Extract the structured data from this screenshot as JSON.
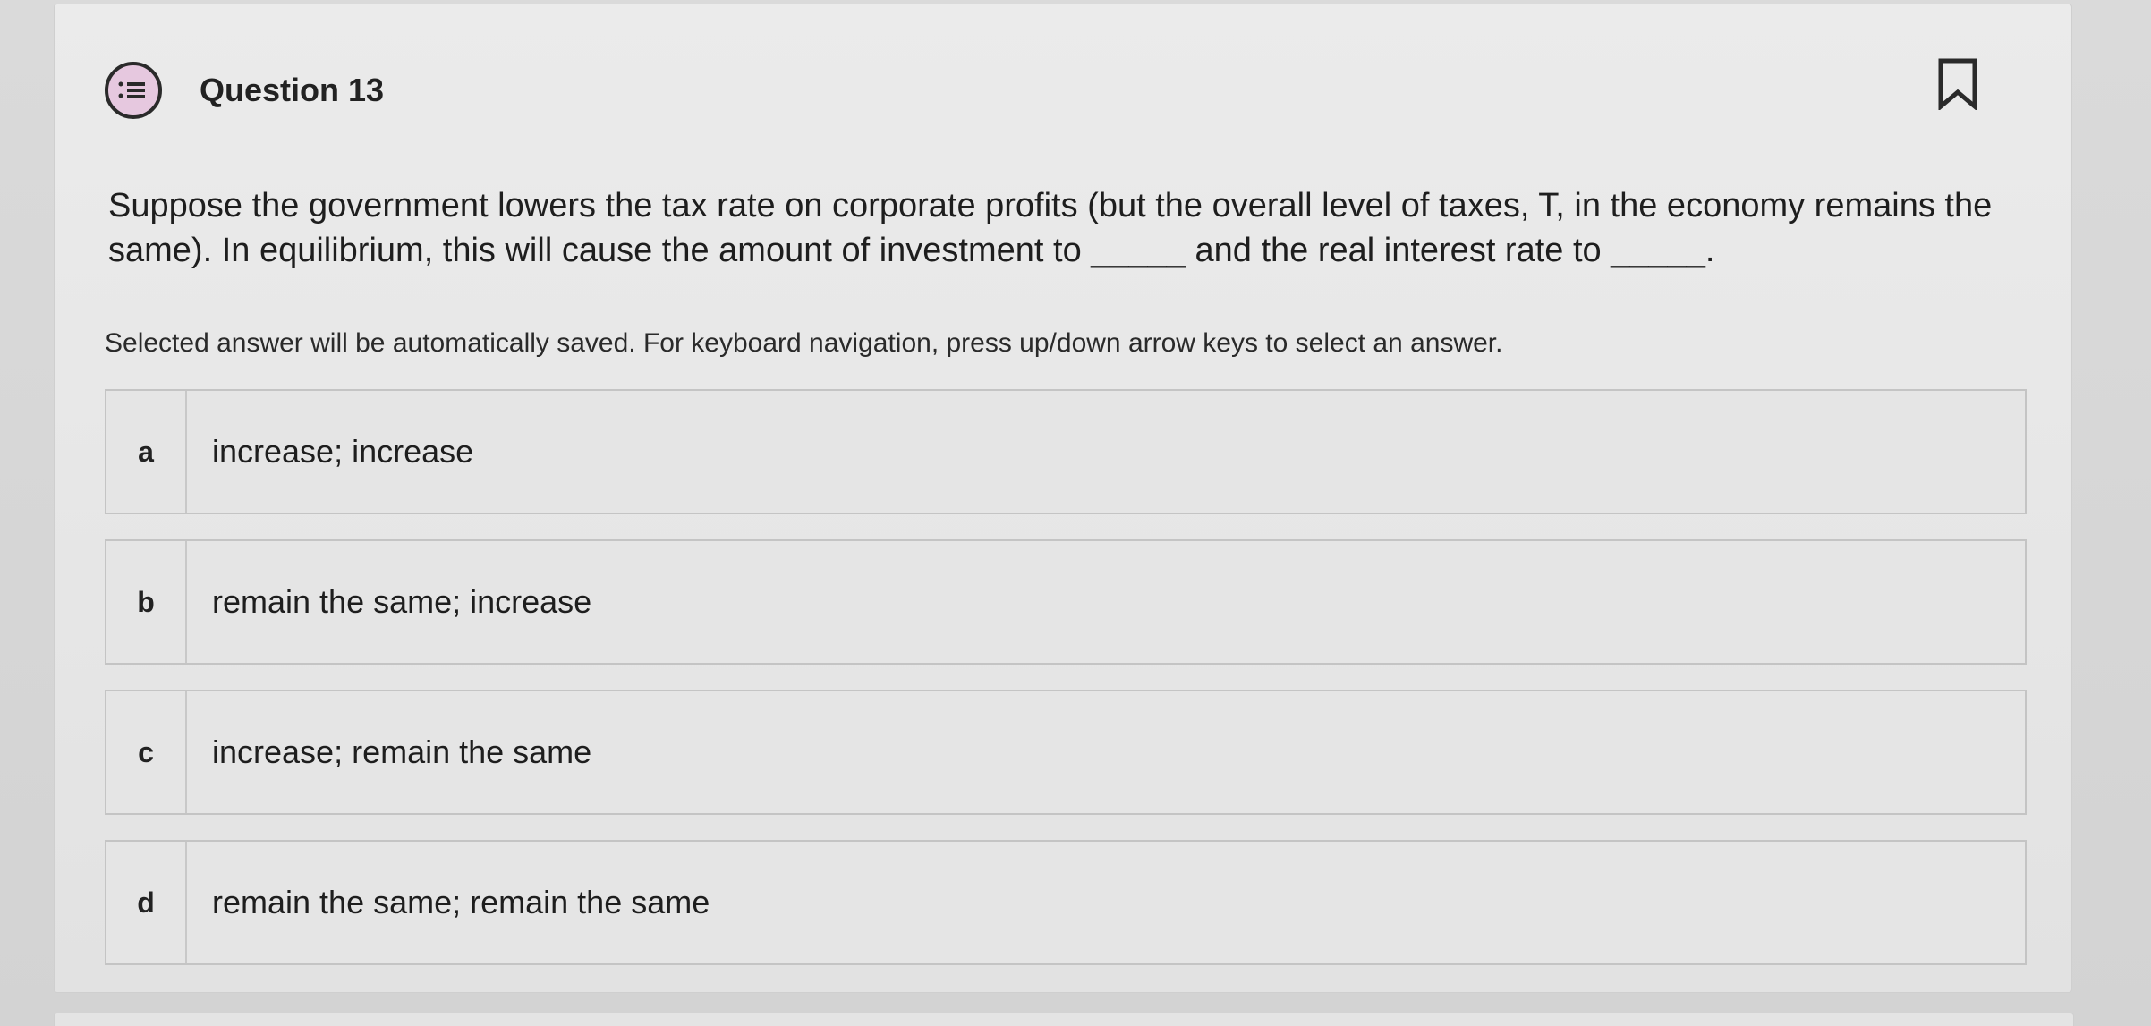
{
  "question": {
    "title": "Question 13",
    "icon": "list-icon",
    "bookmark_icon": "bookmark-icon",
    "text": "Suppose the government lowers the tax rate on corporate profits (but the overall level of taxes, T, in the economy remains the same). In equilibrium, this will cause the amount of investment to _____ and the real interest rate to _____.",
    "instructions": "Selected answer will be automatically saved. For keyboard navigation, press up/down arrow keys to select an answer."
  },
  "options": [
    {
      "letter": "a",
      "text": "increase; increase"
    },
    {
      "letter": "b",
      "text": "remain the same; increase"
    },
    {
      "letter": "c",
      "text": "increase; remain the same"
    },
    {
      "letter": "d",
      "text": "remain the same; remain the same"
    }
  ],
  "colors": {
    "icon_fill": "#e6c8df",
    "text": "#1e1e1e",
    "border": "#c4c4c4"
  }
}
